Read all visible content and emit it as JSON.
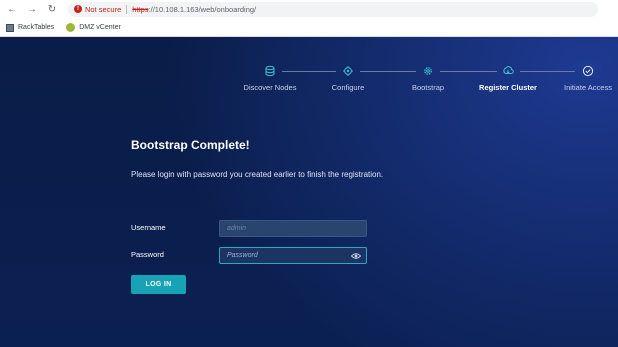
{
  "browser": {
    "security_label": "Not secure",
    "url_scheme": "https",
    "url_rest": "://10.108.1.163/web/onboarding/",
    "bookmarks": [
      {
        "label": "RackTables",
        "icon": "racktables-icon"
      },
      {
        "label": "DMZ vCenter",
        "icon": "vcenter-icon"
      }
    ]
  },
  "stepper": {
    "steps": [
      {
        "label": "Discover Nodes",
        "icon": "database-icon",
        "state": "complete"
      },
      {
        "label": "Configure",
        "icon": "configure-gear-icon",
        "state": "complete"
      },
      {
        "label": "Bootstrap",
        "icon": "gear-icon",
        "state": "complete"
      },
      {
        "label": "Register Cluster",
        "icon": "register-cluster-icon",
        "state": "active"
      },
      {
        "label": "Initiate Access",
        "icon": "check-circle-icon",
        "state": "pending"
      }
    ]
  },
  "main": {
    "title": "Bootstrap Complete!",
    "description": "Please login with password you created earlier to finish the registration.",
    "username_label": "Username",
    "username_value": "admin",
    "password_label": "Password",
    "password_placeholder": "Password",
    "login_button": "LOG IN"
  },
  "colors": {
    "background": "#0b2052",
    "accent": "#16a3b5",
    "not_secure": "#c5221f"
  }
}
